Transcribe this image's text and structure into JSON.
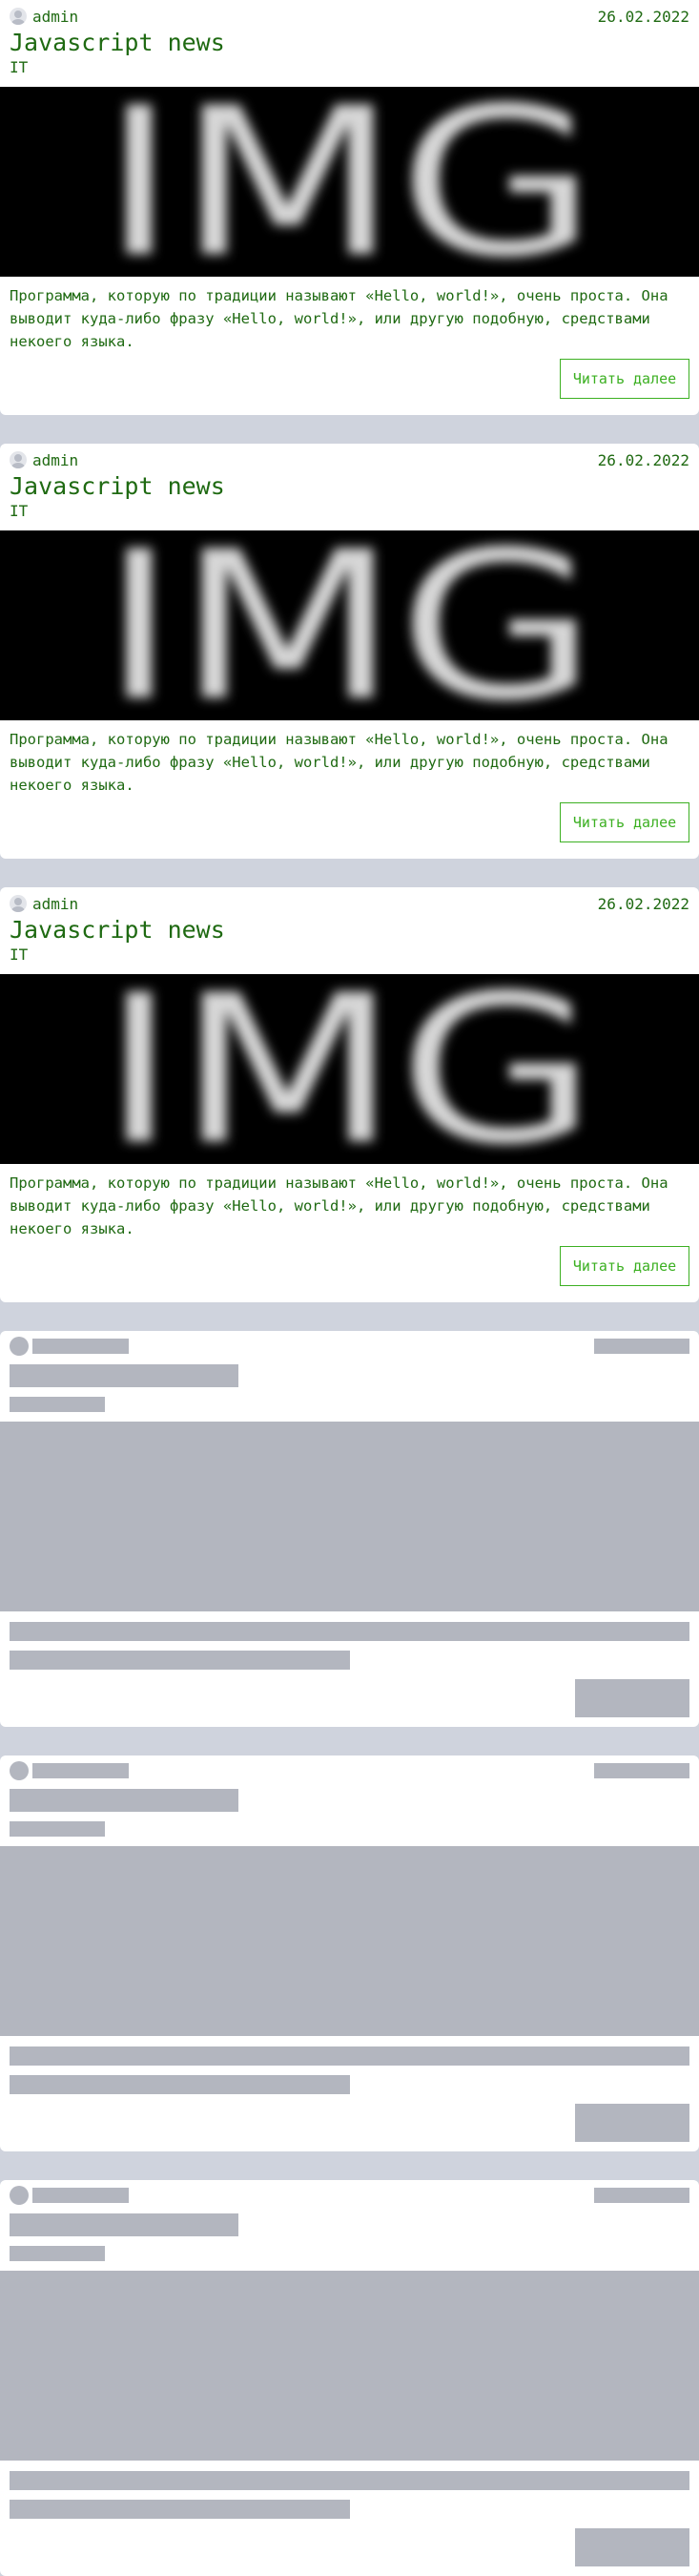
{
  "posts": [
    {
      "author": "admin",
      "date": "26.02.2022",
      "title": "Javascript news",
      "category": "IT",
      "image_label": "IMG",
      "excerpt": "Программа, которую по традиции называют «Hello, world!», очень проста. Она выводит куда-либо фразу «Hello, world!», или другую подобную, средствами некоего языка.",
      "read_more": "Читать далее"
    },
    {
      "author": "admin",
      "date": "26.02.2022",
      "title": "Javascript news",
      "category": "IT",
      "image_label": "IMG",
      "excerpt": "Программа, которую по традиции называют «Hello, world!», очень проста. Она выводит куда-либо фразу «Hello, world!», или другую подобную, средствами некоего языка.",
      "read_more": "Читать далее"
    },
    {
      "author": "admin",
      "date": "26.02.2022",
      "title": "Javascript news",
      "category": "IT",
      "image_label": "IMG",
      "excerpt": "Программа, которую по традиции называют «Hello, world!», очень проста. Она выводит куда-либо фразу «Hello, world!», или другую подобную, средствами некоего языка.",
      "read_more": "Читать далее"
    }
  ],
  "skeleton_cards": 3,
  "colors": {
    "text": "#1f6a12",
    "accent": "#3cb022",
    "page_bg": "#cfd3dd",
    "skeleton": "#b3b6bf"
  },
  "icons": {
    "avatar": "user-avatar-icon"
  }
}
